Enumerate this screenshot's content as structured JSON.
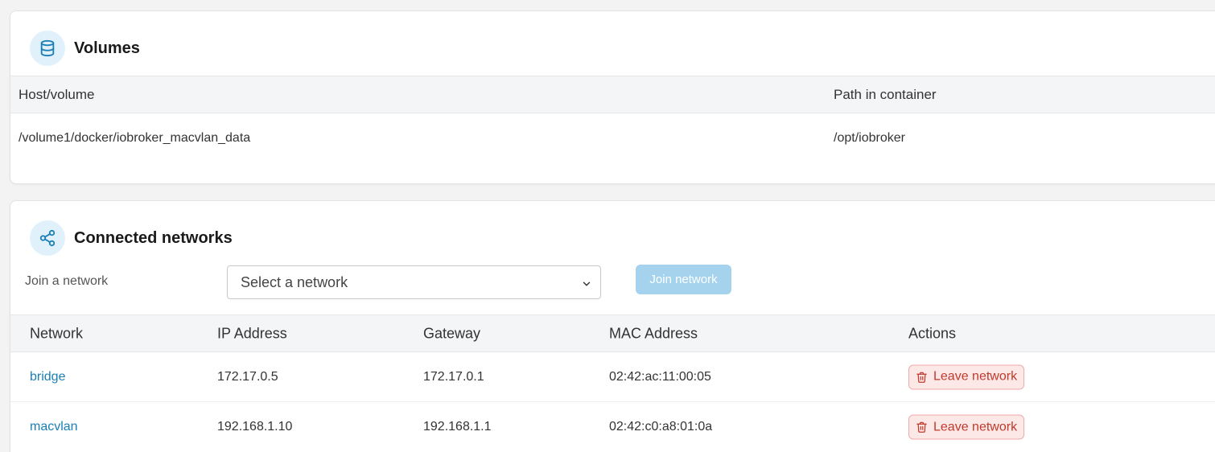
{
  "volumes": {
    "title": "Volumes",
    "icon": "database-icon",
    "columns": {
      "host": "Host/volume",
      "path": "Path in container"
    },
    "rows": [
      {
        "host": "/volume1/docker/iobroker_macvlan_data",
        "path": "/opt/iobroker"
      }
    ]
  },
  "networks": {
    "title": "Connected networks",
    "icon": "share-icon",
    "join_label": "Join a network",
    "select_placeholder": "Select a network",
    "join_button": "Join network",
    "columns": {
      "network": "Network",
      "ip": "IP Address",
      "gateway": "Gateway",
      "mac": "MAC Address",
      "actions": "Actions"
    },
    "rows": [
      {
        "network": "bridge",
        "ip": "172.17.0.5",
        "gateway": "172.17.0.1",
        "mac": "02:42:ac:11:00:05",
        "action": "Leave network"
      },
      {
        "network": "macvlan",
        "ip": "192.168.1.10",
        "gateway": "192.168.1.1",
        "mac": "02:42:c0:a8:01:0a",
        "action": "Leave network"
      }
    ]
  },
  "colors": {
    "accent": "#1a7fb4",
    "danger": "#c0392b",
    "join_button_disabled": "#a5d3ee"
  }
}
